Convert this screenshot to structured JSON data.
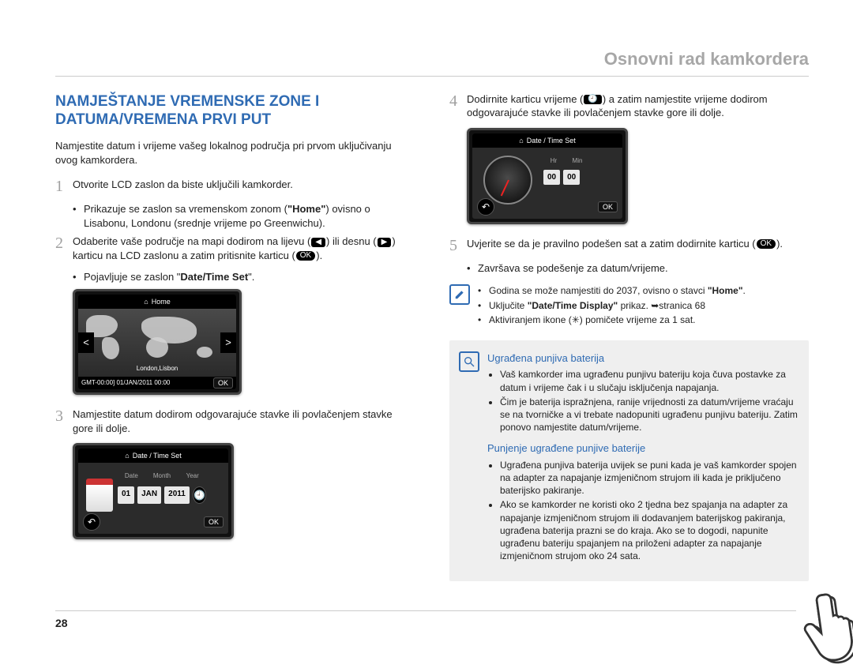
{
  "header": "Osnovni rad kamkordera",
  "title": "NAMJEŠTANJE VREMENSKE ZONE I DATUMA/VREMENA PRVI PUT",
  "intro": "Namjestite datum i vrijeme vašeg lokalnog područja pri prvom uključivanju ovog kamkordera.",
  "steps": {
    "s1": {
      "num": "1",
      "text": "Otvorite LCD zaslon da biste uključili kamkorder.",
      "sub1a": "Prikazuje se zaslon sa vremenskom zonom (",
      "sub1b": ") ovisno o Lisabonu, Londonu (srednje vrijeme po Greenwichu).",
      "home_bold": "\"Home\""
    },
    "s2": {
      "num": "2",
      "text_a": "Odaberite vaše područje na mapi dodirom na lijevu (",
      "text_b": ") ili desnu (",
      "text_c": ") karticu na LCD zaslonu a zatim pritisnite karticu (",
      "text_d": ").",
      "sub_a": "Pojavljuje se zaslon \"",
      "sub_bold": "Date/Time Set",
      "sub_b": "\"."
    },
    "s3": {
      "num": "3",
      "text": "Namjestite datum dodirom odgovarajuće stavke ili povlačenjem stavke gore ili dolje."
    },
    "s4": {
      "num": "4",
      "text_a": "Dodirnite karticu vrijeme (",
      "text_b": ") a zatim namjestite vrijeme dodirom odgovarajuće stavke ili povlačenjem stavke gore ili dolje."
    },
    "s5": {
      "num": "5",
      "text_a": "Uvjerite se da je pravilno podešen sat a zatim dodirnite karticu (",
      "text_b": ").",
      "sub": "Završava se podešenje za datum/vrijeme."
    }
  },
  "lcd1": {
    "top": "Home",
    "city": "London,Lisbon",
    "bottom_left": "GMT-00:00] 01/JAN/2011 00:00",
    "left_arrow": "<",
    "right_arrow": ">",
    "ok": "OK"
  },
  "lcd2": {
    "top": "Date / Time Set",
    "h1": "Date",
    "h2": "Month",
    "h3": "Year",
    "v1": "01",
    "v2": "JAN",
    "v3": "2011",
    "ok": "OK",
    "back": "↶"
  },
  "lcd3": {
    "top": "Date / Time Set",
    "h1": "Hr",
    "h2": "Min",
    "v1": "00",
    "v2": "00",
    "ok": "OK",
    "back": "↶"
  },
  "chips": {
    "left": "◀",
    "right": "▶",
    "ok": "OK",
    "clock": "🕘"
  },
  "tips": {
    "t1_a": "Godina se može namjestiti do 2037, ovisno o stavci ",
    "t1_b": "\"Home\"",
    "t1_c": ".",
    "t2_a": "Uključite ",
    "t2_b": "\"Date/Time Display\"",
    "t2_c": " prikaz. ➥stranica 68",
    "t3_a": "Aktiviranjem ikone (",
    "t3_b": ") pomičete vrijeme za 1 sat.",
    "sun": "✳"
  },
  "info": {
    "h1": "Ugrađena punjiva baterija",
    "l1": "Vaš kamkorder ima ugrađenu punjivu bateriju koja čuva postavke za datum i vrijeme čak i u slučaju isključenja napajanja.",
    "l2": "Čim je baterija ispražnjena, ranije vrijednosti za datum/vrijeme vraćaju se na tvorničke a vi trebate nadopuniti ugrađenu punjivu bateriju. Zatim ponovo namjestite datum/vrijeme.",
    "h2": "Punjenje ugrađene punjive baterije",
    "l3": "Ugrađena punjiva baterija uvijek se puni kada je vaš kamkorder spojen na adapter za napajanje izmjeničnom strujom ili kada je priključeno baterijsko pakiranje.",
    "l4": "Ako se kamkorder ne koristi oko 2 tjedna bez spajanja na adapter za napajanje izmjeničnom strujom ili dodavanjem baterijskog pakiranja, ugrađena baterija prazni se do kraja. Ako se to dogodi, napunite ugrađenu bateriju spajanjem na priloženi adapter za napajanje izmjeničnom strujom oko 24 sata."
  },
  "page_num": "28"
}
